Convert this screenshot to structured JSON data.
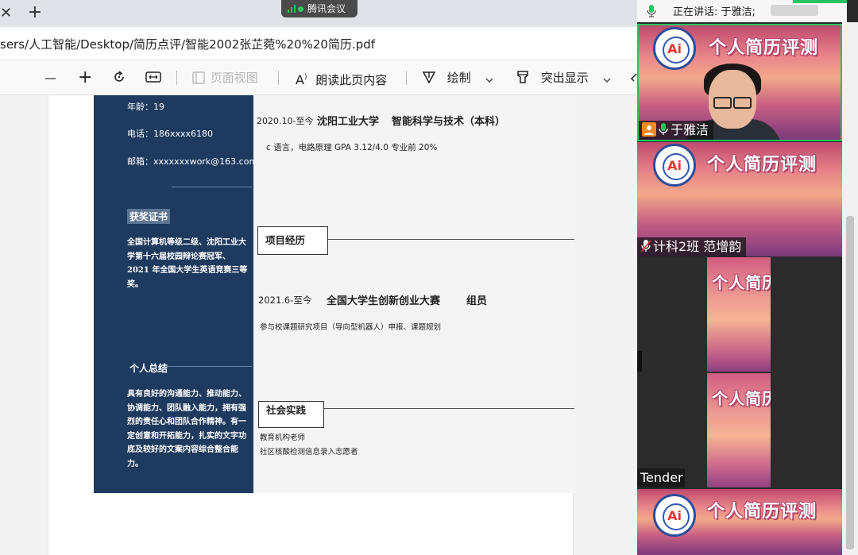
{
  "browser": {
    "url": "sers/人工智能/Desktop/简历点评/智能2002张芷菀%20%20简历.pdf",
    "close_glyph": "✕",
    "new_tab_glyph": "+"
  },
  "meeting_pill": {
    "label": "腾讯会议"
  },
  "pdf_toolbar": {
    "zoom_out": "—",
    "zoom_in": "+",
    "page_view": "页面视图",
    "read_aloud": "朗读此页内容",
    "draw": "绘制",
    "highlight": "突出显示"
  },
  "resume": {
    "age": "年龄：19",
    "phone": "电话：186xxxx6180",
    "email": "邮箱：xxxxxxxwork@163.com",
    "awards_heading": "获奖证书",
    "awards_text": "全国计算机等级二级、沈阳工业大学第十六届校园辩论赛冠军、2021 年全国大学生英语竞赛三等奖。",
    "summary_heading": "个人总结",
    "summary_text": "具有良好的沟通能力、推动能力、协调能力、团队融入能力，拥有强烈的责任心和团队合作精神。有一定创意和开拓能力，扎实的文字功底及较好的文案内容综合整合能力。",
    "education": {
      "period": "2020.10-至今",
      "school": "沈阳工业大学",
      "major": "智能科学与技术（本科）",
      "courses": "c 语言，电路原理 GPA 3.12/4.0  专业前 20%"
    },
    "projects": {
      "heading": "项目经历",
      "period": "2021.6-至今",
      "name": "全国大学生创新创业大赛",
      "role": "组员",
      "desc": "参与校课题研究项目（导向型机器人）申报、课题规划"
    },
    "practice": {
      "heading": "社会实践",
      "line1": "教育机构老师",
      "line2": "社区核酸检测信息录入志愿者"
    }
  },
  "meeting": {
    "speaking_label": "正在讲话: 于雅洁;",
    "banner_text": "个人简历评测",
    "banner_text_cut": "个人简历",
    "logo_text_a": "A",
    "logo_text_i": "i",
    "participants": [
      {
        "name": "于雅洁"
      },
      {
        "name": "计科2班  范增韵"
      },
      {
        "name": ""
      },
      {
        "name": "Tender"
      },
      {
        "name": ""
      }
    ],
    "colors": {
      "active_green": "#22c55e",
      "active_border": "#22c55e"
    }
  }
}
